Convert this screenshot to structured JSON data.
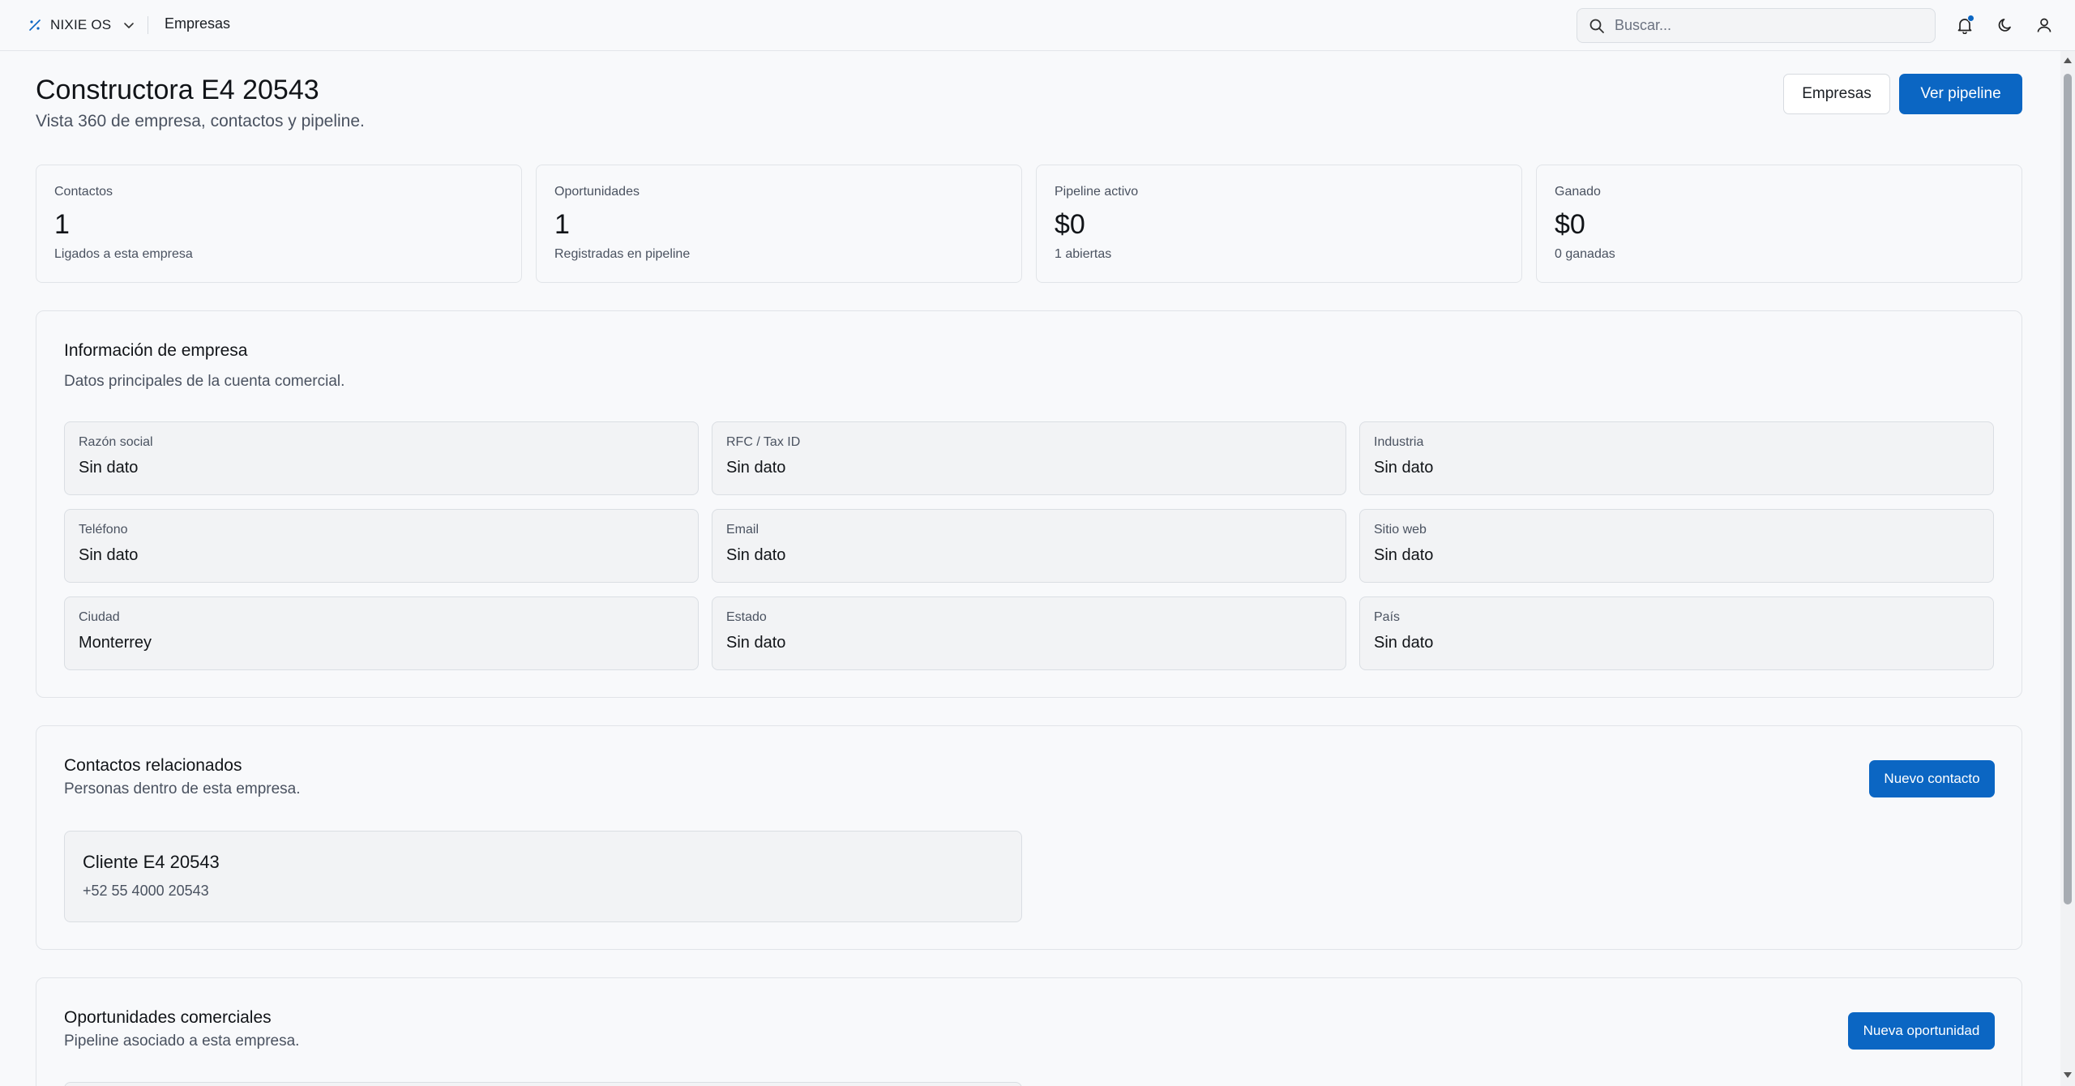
{
  "topbar": {
    "app_name": "NIXIE OS",
    "breadcrumb": "Empresas",
    "search_placeholder": "Buscar..."
  },
  "header": {
    "title": "Constructora E4 20543",
    "subtitle": "Vista 360 de empresa, contactos y pipeline.",
    "btn_companies": "Empresas",
    "btn_pipeline": "Ver pipeline"
  },
  "stats": [
    {
      "label": "Contactos",
      "value": "1",
      "note": "Ligados a esta empresa"
    },
    {
      "label": "Oportunidades",
      "value": "1",
      "note": "Registradas en pipeline"
    },
    {
      "label": "Pipeline activo",
      "value": "$0",
      "note": "1 abiertas"
    },
    {
      "label": "Ganado",
      "value": "$0",
      "note": "0 ganadas"
    }
  ],
  "company_info": {
    "title": "Información de empresa",
    "subtitle": "Datos principales de la cuenta comercial.",
    "fields": [
      {
        "label": "Razón social",
        "value": "Sin dato"
      },
      {
        "label": "RFC / Tax ID",
        "value": "Sin dato"
      },
      {
        "label": "Industria",
        "value": "Sin dato"
      },
      {
        "label": "Teléfono",
        "value": "Sin dato"
      },
      {
        "label": "Email",
        "value": "Sin dato"
      },
      {
        "label": "Sitio web",
        "value": "Sin dato"
      },
      {
        "label": "Ciudad",
        "value": "Monterrey"
      },
      {
        "label": "Estado",
        "value": "Sin dato"
      },
      {
        "label": "País",
        "value": "Sin dato"
      }
    ]
  },
  "contacts": {
    "title": "Contactos relacionados",
    "subtitle": "Personas dentro de esta empresa.",
    "new_button": "Nuevo contacto",
    "items": [
      {
        "name": "Cliente E4 20543",
        "phone": "+52 55 4000 20543"
      }
    ]
  },
  "opportunities": {
    "title": "Oportunidades comerciales",
    "subtitle": "Pipeline asociado a esta empresa.",
    "new_button": "Nueva oportunidad"
  },
  "colors": {
    "primary": "#0b66c3",
    "background": "#f8f9fb",
    "field_bg": "#f2f3f5"
  },
  "icons": [
    "logo-icon",
    "chevron-down-icon",
    "search-icon",
    "bell-icon",
    "moon-icon",
    "user-icon"
  ]
}
